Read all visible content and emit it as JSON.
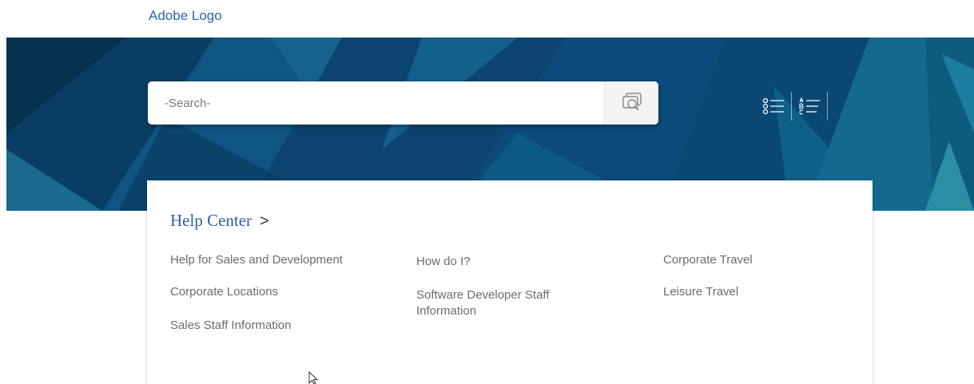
{
  "header": {
    "logo_text": "Adobe Logo"
  },
  "search": {
    "placeholder": "-Search-",
    "button_icon": "search-documents-icon"
  },
  "view_toggle": {
    "list_icon": "numbered-list-icon",
    "alpha_icon": "alphabetical-list-icon"
  },
  "help_center": {
    "title": "Help Center",
    "chevron": ">",
    "columns": [
      [
        "Help for Sales and Development",
        "Corporate Locations",
        "Sales Staff Information"
      ],
      [
        "How do I?",
        "Software Developer Staff Information"
      ],
      [
        "Corporate Travel",
        "Leisure Travel"
      ]
    ]
  },
  "colors": {
    "hero_base": "#0d4f7a",
    "link_blue": "#2f63b4",
    "link_gray": "#6c6c6c"
  }
}
